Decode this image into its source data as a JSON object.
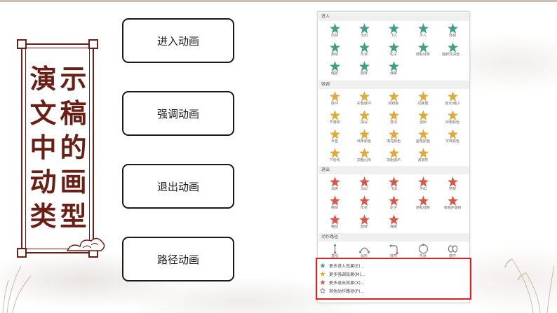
{
  "title_chars": [
    "演",
    "示",
    "文",
    "稿",
    "中",
    "的",
    "动",
    "画",
    "类",
    "型"
  ],
  "buttons": {
    "entrance": "进入动画",
    "emphasis": "强调动画",
    "exit": "退出动画",
    "path": "路径动画"
  },
  "gallery": {
    "sections": {
      "entrance": "进入",
      "emphasis": "强调",
      "exit": "退出",
      "paths": "动作路径"
    },
    "entrance_items": [
      "出现",
      "淡出",
      "飞入",
      "浮入",
      "劈裂",
      "擦除",
      "形状",
      "轮子",
      "随机线条",
      "翻转式由远...",
      "缩放",
      "旋转",
      "弹跳"
    ],
    "emphasis_items": [
      "脉冲",
      "彩色脉冲",
      "跷跷板",
      "陀螺旋",
      "放大/缩小",
      "不饱和",
      "加深",
      "变淡",
      "透明",
      "对象颜色",
      "补色",
      "线条颜色",
      "填充颜色",
      "画笔颜色",
      "字体颜色",
      "下划线",
      "加粗闪烁",
      "加粗展示",
      "波浪形"
    ],
    "exit_items": [
      "消失",
      "淡出",
      "飞出",
      "浮出",
      "劈裂",
      "擦除",
      "形状",
      "轮子",
      "随机线条",
      "收缩并旋转",
      "缩放",
      "旋转",
      "弹跳"
    ],
    "path_items": [
      "直线",
      "弧形",
      "转弯",
      "形状",
      "循环"
    ],
    "more": [
      "更多进入效果(E)...",
      "更多强调效果(M)...",
      "更多退出效果(X)...",
      "其他动作路径(P)..."
    ]
  },
  "colors": {
    "title": "#6b1f14",
    "entrance_star": "#3f9f86",
    "emphasis_star": "#e0a93a",
    "exit_star": "#d9574a",
    "highlight": "#e02020"
  }
}
